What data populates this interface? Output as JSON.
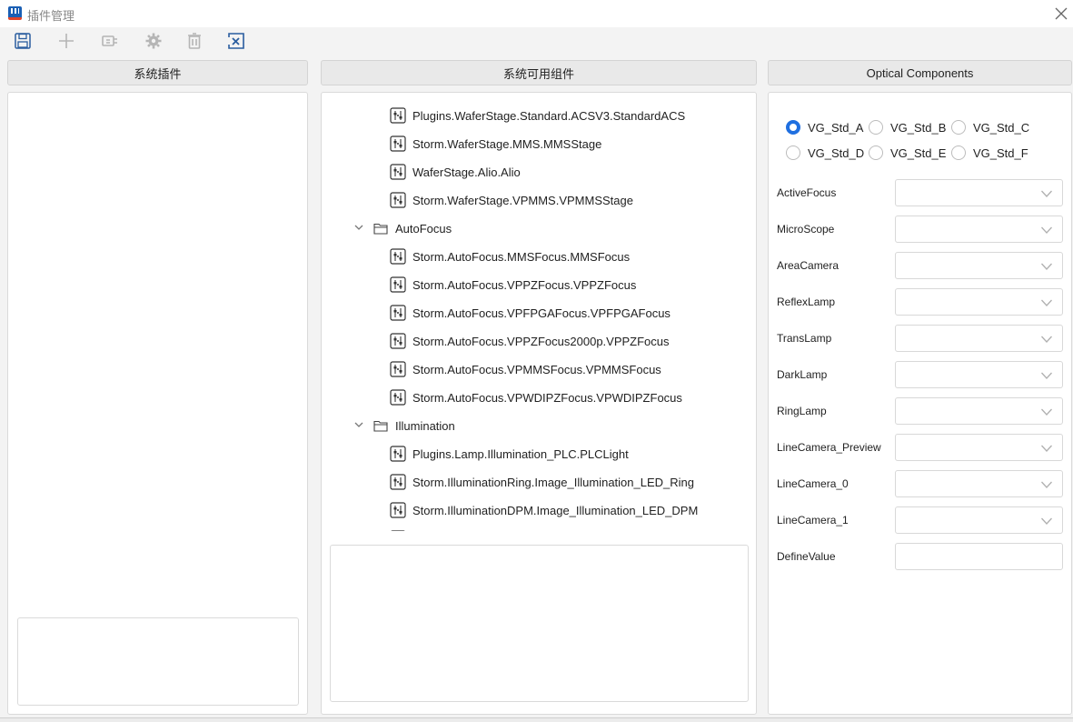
{
  "window": {
    "title": "插件管理"
  },
  "toolbar": {
    "buttons": [
      {
        "icon": "save-icon"
      },
      {
        "icon": "add-icon"
      },
      {
        "icon": "deploy-icon"
      },
      {
        "icon": "gear-icon"
      },
      {
        "icon": "trash-icon"
      },
      {
        "icon": "close-box-icon"
      }
    ]
  },
  "panels": {
    "system_plugins": {
      "header": "系统插件"
    },
    "available_components": {
      "header": "系统可用组件"
    },
    "optical": {
      "header": "Optical Components"
    }
  },
  "tree": {
    "rows": [
      {
        "type": "item",
        "label": "Plugins.WaferStage.Standard.ACSV3.StandardACS"
      },
      {
        "type": "item",
        "label": "Storm.WaferStage.MMS.MMSStage"
      },
      {
        "type": "item",
        "label": "WaferStage.Alio.Alio"
      },
      {
        "type": "item",
        "label": "Storm.WaferStage.VPMMS.VPMMSStage"
      },
      {
        "type": "folder",
        "label": "AutoFocus"
      },
      {
        "type": "item",
        "label": "Storm.AutoFocus.MMSFocus.MMSFocus"
      },
      {
        "type": "item",
        "label": "Storm.AutoFocus.VPPZFocus.VPPZFocus"
      },
      {
        "type": "item",
        "label": "Storm.AutoFocus.VPFPGAFocus.VPFPGAFocus"
      },
      {
        "type": "item",
        "label": "Storm.AutoFocus.VPPZFocus2000p.VPPZFocus"
      },
      {
        "type": "item",
        "label": "Storm.AutoFocus.VPMMSFocus.VPMMSFocus"
      },
      {
        "type": "item",
        "label": "Storm.AutoFocus.VPWDIPZFocus.VPWDIPZFocus"
      },
      {
        "type": "folder",
        "label": "Illumination"
      },
      {
        "type": "item",
        "label": "Plugins.Lamp.Illumination_PLC.PLCLight"
      },
      {
        "type": "item",
        "label": "Storm.IlluminationRing.Image_Illumination_LED_Ring"
      },
      {
        "type": "item",
        "label": "Storm.IlluminationDPM.Image_Illumination_LED_DPM"
      },
      {
        "type": "item",
        "label": ""
      }
    ]
  },
  "optical": {
    "radios": [
      {
        "label": "VG_Std_A",
        "checked": true
      },
      {
        "label": "VG_Std_B",
        "checked": false
      },
      {
        "label": "VG_Std_C",
        "checked": false
      },
      {
        "label": "VG_Std_D",
        "checked": false
      },
      {
        "label": "VG_Std_E",
        "checked": false
      },
      {
        "label": "VG_Std_F",
        "checked": false
      }
    ],
    "fields": [
      {
        "label": "ActiveFocus",
        "kind": "combo",
        "value": ""
      },
      {
        "label": "MicroScope",
        "kind": "combo",
        "value": ""
      },
      {
        "label": "AreaCamera",
        "kind": "combo",
        "value": ""
      },
      {
        "label": "ReflexLamp",
        "kind": "combo",
        "value": ""
      },
      {
        "label": "TransLamp",
        "kind": "combo",
        "value": ""
      },
      {
        "label": "DarkLamp",
        "kind": "combo",
        "value": ""
      },
      {
        "label": "RingLamp",
        "kind": "combo",
        "value": ""
      },
      {
        "label": "LineCamera_Preview",
        "kind": "combo",
        "value": ""
      },
      {
        "label": "LineCamera_0",
        "kind": "combo",
        "value": ""
      },
      {
        "label": "LineCamera_1",
        "kind": "combo",
        "value": ""
      },
      {
        "label": "DefineValue",
        "kind": "text",
        "value": ""
      }
    ]
  },
  "colors": {
    "accent": "#1f6fe0",
    "panel_bg": "#ffffff",
    "window_bg": "#f3f3f3"
  }
}
